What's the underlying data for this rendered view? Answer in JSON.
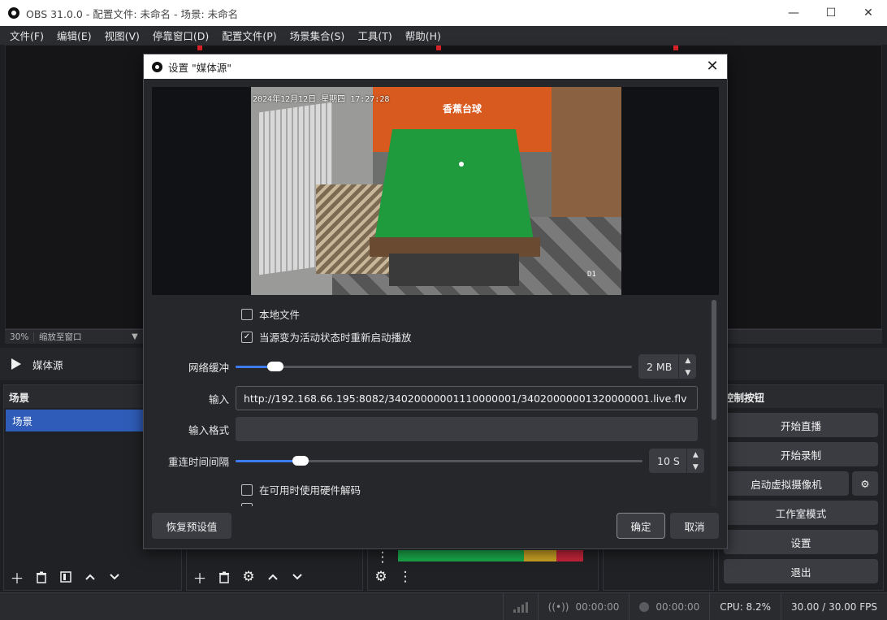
{
  "window": {
    "title": "OBS 31.0.0 - 配置文件: 未命名 - 场景: 未命名",
    "controls": {
      "minimize": "—",
      "maximize": "☐",
      "close": "✕"
    }
  },
  "menu": [
    "文件(F)",
    "编辑(E)",
    "视图(V)",
    "停靠窗口(D)",
    "配置文件(P)",
    "场景集合(S)",
    "工具(T)",
    "帮助(H)"
  ],
  "preview": {
    "zoom": "30%",
    "zoom_mode": "缩放至窗口"
  },
  "source_bar": {
    "name": "媒体源"
  },
  "scenes": {
    "title": "场景",
    "items": [
      "场景"
    ]
  },
  "controls": {
    "title": "控制按钮",
    "start_stream": "开始直播",
    "start_record": "开始录制",
    "virtual_cam": "启动虚拟摄像机",
    "studio_mode": "工作室模式",
    "settings": "设置",
    "exit": "退出"
  },
  "status": {
    "rec_time": "00:00:00",
    "stream_time": "00:00:00",
    "cpu": "CPU: 8.2%",
    "fps": "30.00 / 30.00 FPS"
  },
  "dialog": {
    "title": "设置 \"媒体源\"",
    "video_osd": {
      "timestamp": "2024年12月12日 星期四 17:27:28",
      "sign": "香蕉台球",
      "camera": "D1"
    },
    "local_file": {
      "label": "本地文件",
      "checked": false
    },
    "restart_on_active": {
      "label": "当源变为活动状态时重新启动播放",
      "checked": true
    },
    "network_buffer": {
      "label": "网络缓冲",
      "value": "2 MB",
      "level": 0.1
    },
    "input": {
      "label": "输入",
      "value": "http://192.168.66.195:8082/34020000001110000001/34020000001320000001.live.flv"
    },
    "input_format": {
      "label": "输入格式",
      "value": ""
    },
    "reconnect_interval": {
      "label": "重连时间间隔",
      "value": "10 S",
      "level": 0.16
    },
    "hw_decode": {
      "label": "在可用时使用硬件解码",
      "checked": false
    },
    "buttons": {
      "defaults": "恢复预设值",
      "ok": "确定",
      "cancel": "取消"
    }
  },
  "colors": {
    "accent": "#3c7cf0",
    "scene_selected": "#2f5cb8",
    "rec_red": "#e0232a"
  }
}
